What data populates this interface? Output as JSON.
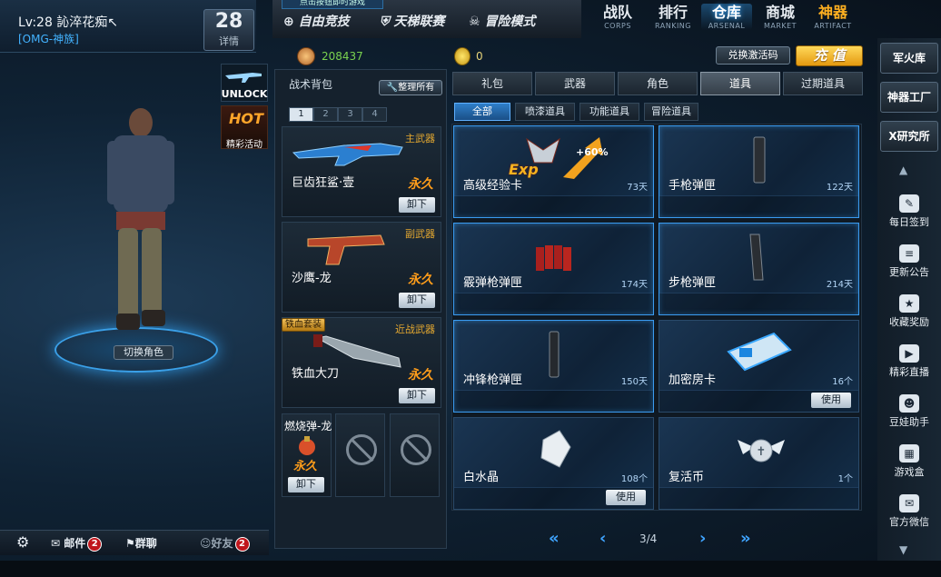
{
  "player": {
    "level": "Lv:28 訫淬花痴↖",
    "clan": "[OMG-神族]",
    "rank": "28",
    "rank_detail": "详情"
  },
  "left_icons": {
    "unlock": "UNLOCK",
    "hot": "HOT",
    "hot_label": "精彩活动"
  },
  "switch_role": "切换角色",
  "bottom_bar": {
    "mail": "邮件",
    "mail_count": "2",
    "group_chat": "群聊",
    "friends": "好友",
    "friends_count": "2"
  },
  "modes": {
    "hint": "点击按钮即时游戏",
    "free": "自由竞技",
    "ladder": "天梯联赛",
    "adventure": "冒险模式"
  },
  "nav": [
    {
      "cn": "战队",
      "en": "CORPS"
    },
    {
      "cn": "排行",
      "en": "RANKING"
    },
    {
      "cn": "仓库",
      "en": "ARSENAL"
    },
    {
      "cn": "商城",
      "en": "MARKET"
    },
    {
      "cn": "神器",
      "en": "ARTIFACT"
    }
  ],
  "currency": {
    "coupon": "208437",
    "gold": "0",
    "redeem": "兑换激活码",
    "charge": "充 值"
  },
  "backpack": {
    "title": "战术背包",
    "organize": "整理所有",
    "pages": [
      "1",
      "2",
      "3",
      "4"
    ],
    "slots": [
      {
        "category": "主武器",
        "name": "巨齿狂鲨·壹",
        "duration": "永久",
        "action": "卸下"
      },
      {
        "category": "副武器",
        "name": "沙鹰-龙",
        "duration": "永久",
        "action": "卸下"
      },
      {
        "category": "近战武器",
        "name": "铁血大刀",
        "duration": "永久",
        "action": "卸下",
        "tag": "铁血套装"
      }
    ],
    "grenade": {
      "name": "燃烧弹-龙",
      "duration": "永久",
      "action": "卸下"
    }
  },
  "tabs": [
    "礼包",
    "武器",
    "角色",
    "道具",
    "过期道具"
  ],
  "subtabs": [
    "全部",
    "喷漆道具",
    "功能道具",
    "冒险道具"
  ],
  "items": [
    {
      "name": "高级经验卡",
      "duration": "73天",
      "badge": "Exp",
      "bonus": "+60%"
    },
    {
      "name": "手枪弹匣",
      "duration": "122天"
    },
    {
      "name": "霰弹枪弹匣",
      "duration": "174天"
    },
    {
      "name": "步枪弹匣",
      "duration": "214天"
    },
    {
      "name": "冲锋枪弹匣",
      "duration": "150天"
    },
    {
      "name": "加密房卡",
      "duration": "16个",
      "action": "使用"
    },
    {
      "name": "白水晶",
      "duration": "108个",
      "action": "使用"
    },
    {
      "name": "复活币",
      "duration": "1个"
    }
  ],
  "pager": {
    "current": "3/4"
  },
  "sidebar": {
    "buttons": [
      "军火库",
      "神器工厂",
      "X研究所"
    ],
    "items": [
      "每日签到",
      "更新公告",
      "收藏奖励",
      "精彩直播",
      "豆娃助手",
      "游戏盒",
      "官方微信"
    ]
  }
}
